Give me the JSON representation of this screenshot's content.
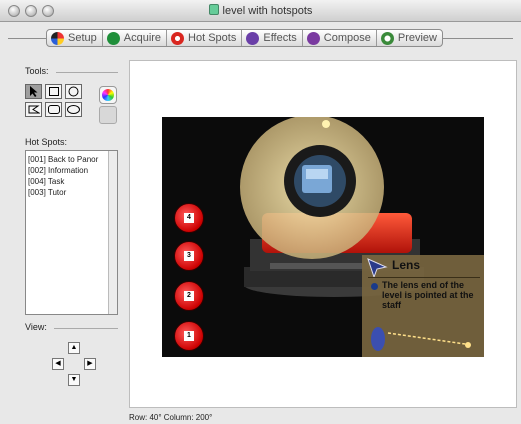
{
  "window": {
    "title": "level with hotspots"
  },
  "tabs": [
    {
      "label": "Setup",
      "icon": "setup-icon",
      "color": "#2b5fd9"
    },
    {
      "label": "Acquire",
      "icon": "acquire-icon",
      "color": "#1f8f3a"
    },
    {
      "label": "Hot Spots",
      "icon": "hotspots-icon",
      "color": "#d9261f"
    },
    {
      "label": "Effects",
      "icon": "effects-icon",
      "color": "#6a3fa8"
    },
    {
      "label": "Compose",
      "icon": "compose-icon",
      "color": "#7a3aa0"
    },
    {
      "label": "Preview",
      "icon": "preview-icon",
      "color": "#3a8a3a"
    }
  ],
  "sidebar": {
    "tools_label": "Tools:",
    "hotspots_label": "Hot Spots:",
    "view_label": "View:",
    "hotspots": [
      "[001] Back to Panor",
      "[002] Information",
      "[004] Task",
      "[003] Tutor"
    ],
    "arrows": {
      "up": "▲",
      "down": "▼",
      "left": "◀",
      "right": "▶"
    }
  },
  "stage": {
    "hotspot_buttons": [
      "4",
      "3",
      "2",
      "1"
    ],
    "info": {
      "title": "Lens",
      "body": "The lens end of the level is pointed at the staff"
    }
  },
  "status": {
    "text": "Row: 40°    Column: 200°"
  },
  "colors": {
    "window_bg": "#e8e8e8",
    "canvas_bg": "#ffffff",
    "stage_bg": "#0b0b0b",
    "hotspot_red": "#cc0000",
    "highlight_tan": "#e8d8a0"
  }
}
